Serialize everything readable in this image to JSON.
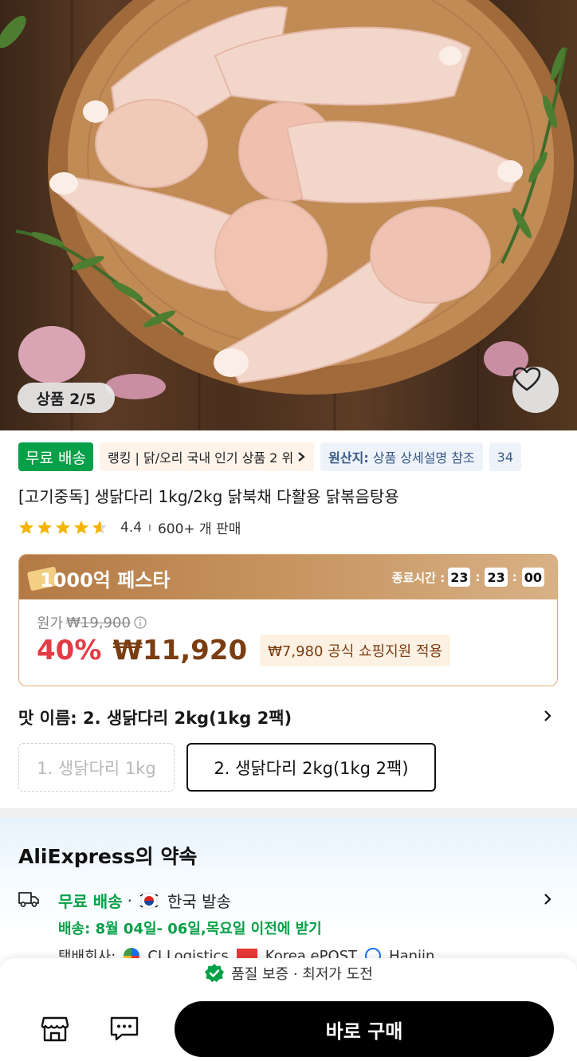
{
  "gallery": {
    "counter": "상품 2/5"
  },
  "tags": {
    "free_shipping": "무료 배송",
    "ranking": "랭킹 | 닭/오리 국내 인기 상품 2 위",
    "origin_label": "원산지:",
    "origin_value": "상품 상세설명 참조",
    "extra": "34"
  },
  "product": {
    "title": "[고기중독] 생닭다리 1kg/2kg 닭북채 다활용 닭볶음탕용",
    "rating": "4.4",
    "sold": "600+ 개 판매"
  },
  "promo": {
    "title": "1000억 페스타",
    "timer_label": "종료시간 :",
    "hours": "23",
    "minutes": "23",
    "seconds": "00",
    "original_label": "원가",
    "original_price": "₩19,900",
    "discount": "40%",
    "price": "₩11,920",
    "subsidy": "₩7,980 공식 쇼핑지원 적용"
  },
  "options": {
    "header": "맛 이름: 2. 생닭다리 2kg(1kg 2팩)",
    "items": [
      "1. 생닭다리 1kg",
      "2. 생닭다리 2kg(1kg 2팩)"
    ]
  },
  "promise": {
    "title": "AliExpress의 약속",
    "free_shipping": "무료 배송",
    "dot": "·",
    "origin": "한국 발송",
    "delivery": "배송: 8월 04일- 06일,목요일 이전에 받기",
    "carrier_label": "택배회사:",
    "carriers": [
      "CJ Logistics",
      "Korea ePOST",
      "Hanjin"
    ]
  },
  "bottom": {
    "guarantee": "품질 보증 · 최저가 도전",
    "buy_label": "바로 구매"
  },
  "colors": {
    "green": "#05a047",
    "price_brown": "#7a3d11",
    "discount_red": "#e33c45",
    "promo_gold": "#c99763"
  }
}
